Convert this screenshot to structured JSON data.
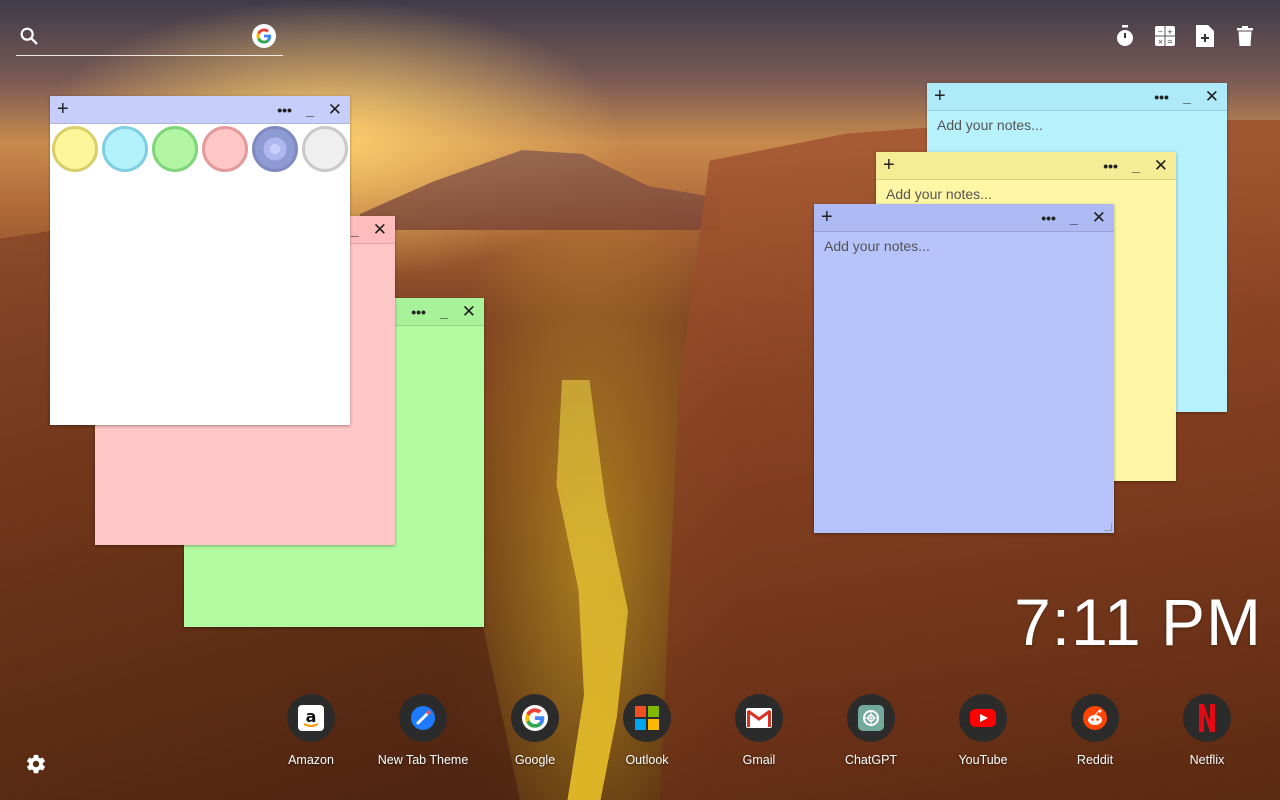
{
  "search": {
    "placeholder": ""
  },
  "tools": [
    {
      "name": "timer-icon"
    },
    {
      "name": "calculator-icon"
    },
    {
      "name": "new-note-icon"
    },
    {
      "name": "trash-icon"
    }
  ],
  "notes": {
    "white": {
      "plus": "+",
      "more": "•••",
      "minimize": "_",
      "close": "✕"
    },
    "pink": {
      "close": "✕",
      "minimize": "_"
    },
    "green": {
      "more": "•••",
      "minimize": "_",
      "close": "✕"
    },
    "cyan": {
      "plus": "+",
      "more": "•••",
      "minimize": "_",
      "close": "✕",
      "placeholder": "Add your notes..."
    },
    "yellow": {
      "plus": "+",
      "more": "•••",
      "minimize": "_",
      "close": "✕",
      "placeholder": "Add your notes..."
    },
    "blue": {
      "plus": "+",
      "more": "•••",
      "minimize": "_",
      "close": "✕",
      "placeholder": "Add your notes..."
    }
  },
  "swatches": [
    {
      "name": "yellow",
      "fill": "#fff59a",
      "ring": "#d9cf6a"
    },
    {
      "name": "cyan",
      "fill": "#b3f1fb",
      "ring": "#7fcfe0"
    },
    {
      "name": "green",
      "fill": "#b2f5a2",
      "ring": "#7fd57a"
    },
    {
      "name": "pink",
      "fill": "#ffc6c6",
      "ring": "#e39a9a"
    },
    {
      "name": "blue",
      "fill": "#b9c4fb",
      "ring": "#7f8bc0"
    },
    {
      "name": "grey",
      "fill": "#efefef",
      "ring": "#c9c9c9"
    }
  ],
  "clock": {
    "time": "7:11 PM"
  },
  "dock": [
    {
      "label": "Amazon",
      "icon": "amazon-icon"
    },
    {
      "label": "New Tab Theme",
      "icon": "new-tab-theme-icon"
    },
    {
      "label": "Google",
      "icon": "google-icon"
    },
    {
      "label": "Outlook",
      "icon": "outlook-icon"
    },
    {
      "label": "Gmail",
      "icon": "gmail-icon"
    },
    {
      "label": "ChatGPT",
      "icon": "chatgpt-icon"
    },
    {
      "label": "YouTube",
      "icon": "youtube-icon"
    },
    {
      "label": "Reddit",
      "icon": "reddit-icon"
    },
    {
      "label": "Netflix",
      "icon": "netflix-icon"
    }
  ],
  "colors": {
    "note_white": "#ffffff",
    "note_pink": "#ffc6c6",
    "note_green": "#b2fba0",
    "note_cyan": "#b6f1fc",
    "note_yellow": "#fff6a6",
    "note_blue": "#b7c3fb",
    "bar_white": "#c7cefa",
    "bar_pink": "#ffbcbc",
    "bar_green": "#a8f29a",
    "bar_cyan": "#aeeaf7",
    "bar_yellow": "#f6ec96",
    "bar_blue": "#aebaf4"
  }
}
